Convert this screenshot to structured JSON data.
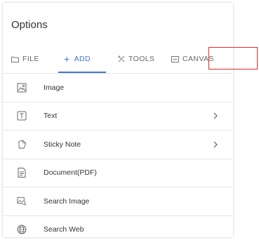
{
  "panel": {
    "title": "Options"
  },
  "tabs": [
    {
      "label": "FILE",
      "icon": "folder-icon"
    },
    {
      "label": "ADD",
      "icon": "plus-icon",
      "active": true
    },
    {
      "label": "TOOLS",
      "icon": "tools-icon"
    },
    {
      "label": "CANVAS",
      "icon": "canvas-icon"
    }
  ],
  "items": [
    {
      "label": "Image",
      "icon": "image-icon",
      "has_submenu": false
    },
    {
      "label": "Text",
      "icon": "text-icon",
      "has_submenu": true
    },
    {
      "label": "Sticky Note",
      "icon": "sticky-note-icon",
      "has_submenu": true
    },
    {
      "label": "Document(PDF)",
      "icon": "document-icon",
      "has_submenu": false
    },
    {
      "label": "Search Image",
      "icon": "search-image-icon",
      "has_submenu": false
    },
    {
      "label": "Search Web",
      "icon": "globe-icon",
      "has_submenu": false
    }
  ],
  "colors": {
    "accent": "#3f78c8",
    "highlight": "#e0282a",
    "text": "#333333"
  }
}
